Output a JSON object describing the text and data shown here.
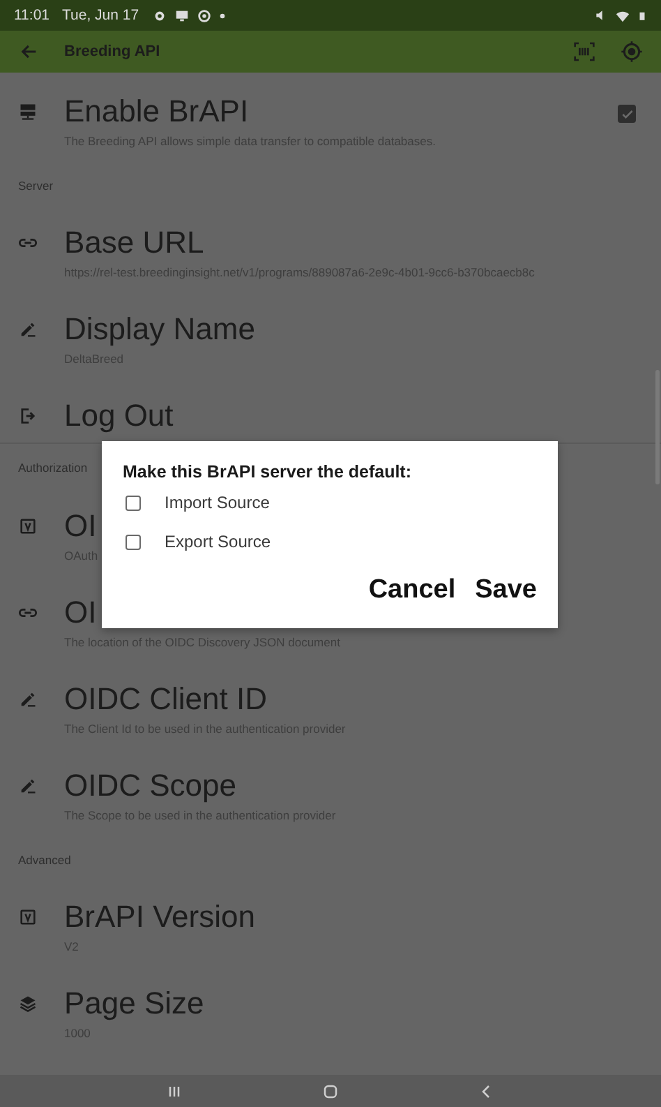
{
  "status_bar": {
    "time": "11:01",
    "date": "Tue, Jun 17"
  },
  "app_bar": {
    "title": "Breeding API"
  },
  "settings": [
    {
      "kind": "item",
      "title": "Enable BrAPI",
      "summary": "The Breeding API allows simple data transfer to compatible databases.",
      "checked": true
    },
    {
      "kind": "header",
      "title": "Server"
    },
    {
      "kind": "item",
      "title": "Base URL",
      "summary": "https://rel-test.breedinginsight.net/v1/programs/889087a6-2e9c-4b01-9cc6-b370bcaecb8c"
    },
    {
      "kind": "item",
      "title": "Display Name",
      "summary": "DeltaBreed"
    },
    {
      "kind": "item",
      "title": "Log Out"
    },
    {
      "kind": "header",
      "title": "Authorization"
    },
    {
      "kind": "item",
      "title": "OI",
      "summary": "OAuth"
    },
    {
      "kind": "item",
      "title": "OI",
      "summary": "The location of the OIDC Discovery JSON document"
    },
    {
      "kind": "item",
      "title": "OIDC Client ID",
      "summary": "The Client Id to be used in the authentication provider"
    },
    {
      "kind": "item",
      "title": "OIDC Scope",
      "summary": "The Scope to be used in the authentication provider"
    },
    {
      "kind": "header",
      "title": "Advanced"
    },
    {
      "kind": "item",
      "title": "BrAPI Version",
      "summary": "V2"
    },
    {
      "kind": "item",
      "title": "Page Size",
      "summary": "1000"
    }
  ],
  "dialog": {
    "title": "Make this BrAPI server the default:",
    "options": [
      {
        "label": "Import Source",
        "checked": false
      },
      {
        "label": "Export Source",
        "checked": false
      }
    ],
    "buttons": [
      "Cancel",
      "Save"
    ]
  }
}
